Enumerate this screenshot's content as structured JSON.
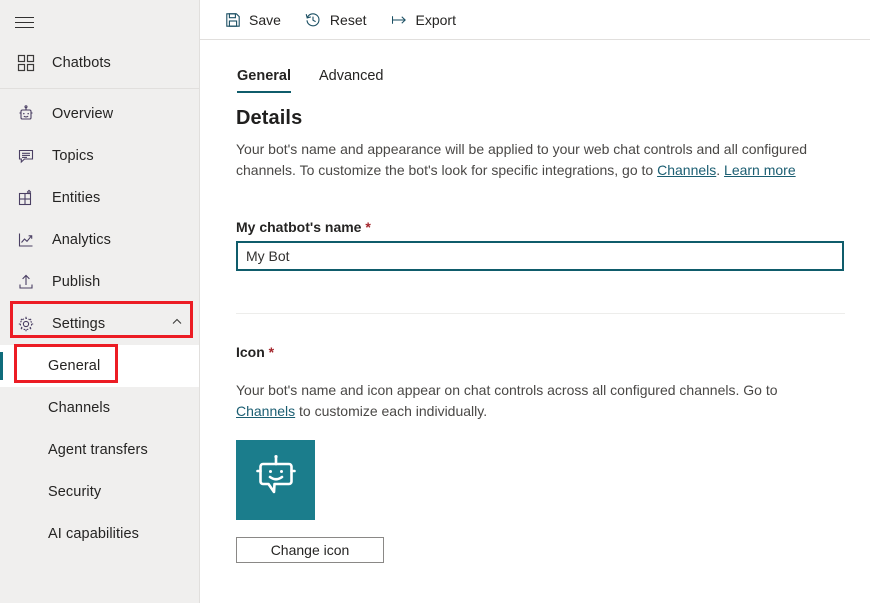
{
  "sidebar": {
    "menu_icon": "hamburger-icon",
    "top_item": {
      "label": "Chatbots",
      "icon": "grid-icon"
    },
    "items": [
      {
        "label": "Overview",
        "icon": "robot-icon"
      },
      {
        "label": "Topics",
        "icon": "chat-icon"
      },
      {
        "label": "Entities",
        "icon": "entities-icon"
      },
      {
        "label": "Analytics",
        "icon": "analytics-icon"
      },
      {
        "label": "Publish",
        "icon": "publish-icon"
      },
      {
        "label": "Settings",
        "icon": "gear-icon"
      }
    ],
    "settings_expanded_chevron": "chevron-up-icon",
    "sub_items": [
      {
        "label": "General",
        "selected": true
      },
      {
        "label": "Channels",
        "selected": false
      },
      {
        "label": "Agent transfers",
        "selected": false
      },
      {
        "label": "Security",
        "selected": false
      },
      {
        "label": "AI capabilities",
        "selected": false
      }
    ]
  },
  "toolbar": {
    "save_label": "Save",
    "reset_label": "Reset",
    "export_label": "Export"
  },
  "tabs": [
    {
      "label": "General",
      "active": true
    },
    {
      "label": "Advanced",
      "active": false
    }
  ],
  "details": {
    "title": "Details",
    "description_part1": "Your bot's name and appearance will be applied to your web chat controls and all configured channels. To customize the bot's look for specific integrations, go to ",
    "link_channels": "Channels",
    "description_part2": ". ",
    "link_learn_more": "Learn more",
    "name_label": "My chatbot's name",
    "required_mark": "*",
    "name_value": "My Bot",
    "name_placeholder": "My Bot"
  },
  "icon_section": {
    "label": "Icon",
    "required_mark": "*",
    "description_part1": "Your bot's name and icon appear on chat controls across all configured channels. Go to ",
    "link_channels": "Channels",
    "description_part2": " to customize each individually.",
    "bot_icon_name": "bot-avatar-icon",
    "change_button_label": "Change icon"
  },
  "colors": {
    "accent_teal": "#1b7d8c",
    "tab_underline": "#0f5c6b",
    "input_border": "#0f5c6b",
    "annotation_red": "#ec1c24",
    "sidebar_bg": "#f0efee",
    "required_red": "#a4262c"
  },
  "annotations": [
    {
      "name": "highlight-settings",
      "target": "Settings"
    },
    {
      "name": "highlight-general",
      "target": "General"
    }
  ]
}
